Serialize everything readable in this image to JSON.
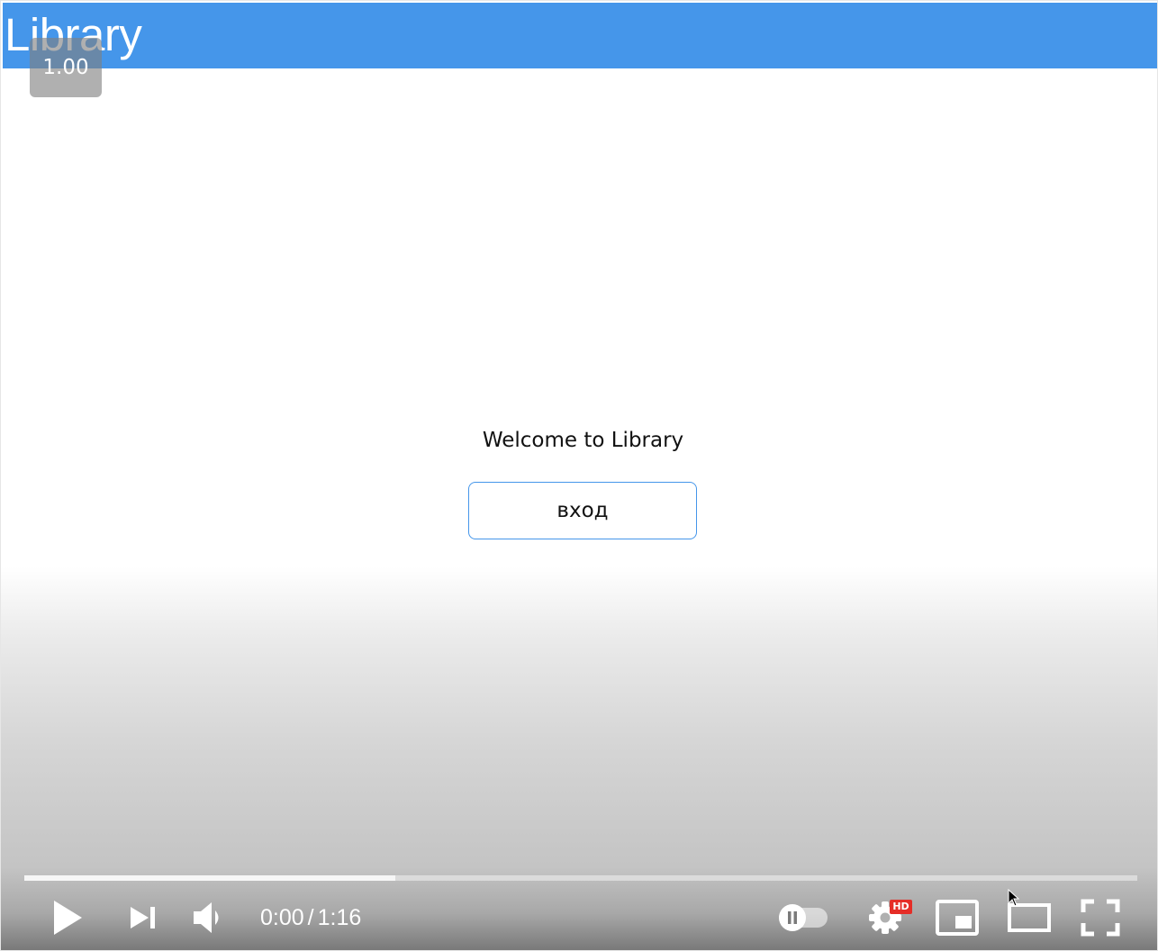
{
  "app": {
    "title": "Library"
  },
  "player_overlay": {
    "speed_badge": "1.00"
  },
  "main": {
    "welcome_text": "Welcome to Library",
    "login_button_label": "вход"
  },
  "player": {
    "time_current": "0:00",
    "time_separator": "/",
    "time_total": "1:16",
    "buffered_fraction": 0.333,
    "played_fraction": 0.0,
    "state": "paused",
    "autoplay_toggle": "off",
    "settings_badge": "HD",
    "icons": [
      "play-icon",
      "next-icon",
      "volume-icon",
      "autoplay-toggle-icon",
      "settings-icon",
      "miniplayer-icon",
      "theater-mode-icon",
      "fullscreen-icon"
    ]
  },
  "colors": {
    "header_bg": "#4596ea",
    "button_border": "#4596ea",
    "hd_badge": "#e52d27",
    "controls": "#ffffff"
  }
}
